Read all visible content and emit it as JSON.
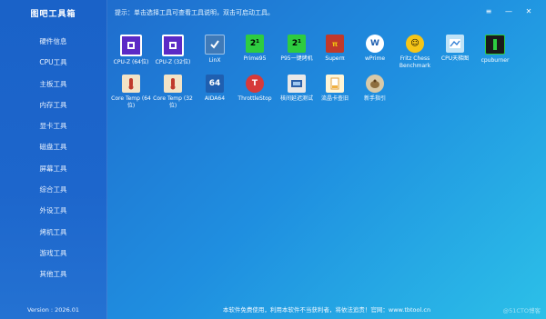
{
  "app": {
    "title": "图吧工具箱",
    "version": "Version : 2026.01"
  },
  "sidebar": {
    "items": [
      {
        "label": "硬件信息"
      },
      {
        "label": "CPU工具"
      },
      {
        "label": "主板工具"
      },
      {
        "label": "内存工具"
      },
      {
        "label": "显卡工具"
      },
      {
        "label": "磁盘工具"
      },
      {
        "label": "屏幕工具"
      },
      {
        "label": "综合工具"
      },
      {
        "label": "外设工具"
      },
      {
        "label": "烤机工具"
      },
      {
        "label": "游戏工具"
      },
      {
        "label": "其他工具"
      }
    ]
  },
  "topbar": {
    "hint": "提示：单击选择工具可查看工具说明，双击可启动工具。",
    "menu_icon": "≡",
    "minimize_icon": "—",
    "close_icon": "✕"
  },
  "tools": [
    {
      "label": "CPU-Z (64位)",
      "icon": "cpu-chip-icon",
      "color": "#5b2ac6"
    },
    {
      "label": "CPU-Z (32位)",
      "icon": "cpu-chip-icon",
      "color": "#5b2ac6"
    },
    {
      "label": "LinX",
      "icon": "linx-icon",
      "color": "#3f7ab8"
    },
    {
      "label": "Prime95",
      "icon": "prime95-icon",
      "color": "#2ecc40"
    },
    {
      "label": "P95一键烤机",
      "icon": "prime95-icon",
      "color": "#2ecc40"
    },
    {
      "label": "Superπ",
      "icon": "superpi-icon",
      "color": "#c0392b"
    },
    {
      "label": "wPrime",
      "icon": "wprime-icon",
      "color": "#ffffff"
    },
    {
      "label": "Fritz Chess Benchmark",
      "icon": "fritz-smiley-icon",
      "color": "#f5c518"
    },
    {
      "label": "CPU天梯图",
      "icon": "cpu-ladder-icon",
      "color": "#bfe3f7"
    },
    {
      "label": "cpuburner",
      "icon": "cpuburner-icon",
      "color": "#1a1a1a"
    },
    {
      "label": "Core Temp (64位)",
      "icon": "thermometer-icon",
      "color": "#f2e3c6"
    },
    {
      "label": "Core Temp (32位)",
      "icon": "thermometer-icon",
      "color": "#f2e3c6"
    },
    {
      "label": "AIDA64",
      "icon": "aida64-icon",
      "color": "#1f5fb0",
      "text": "64"
    },
    {
      "label": "ThrottleStop",
      "icon": "throttlestop-icon",
      "color": "#d63a3a",
      "text": "T"
    },
    {
      "label": "核间延迟测试",
      "icon": "latency-icon",
      "color": "#e8e8e8"
    },
    {
      "label": "流晶卡查旧",
      "icon": "document-icon",
      "color": "#fff5d6"
    },
    {
      "label": "新手指引",
      "icon": "teapot-icon",
      "color": "#d8c9a8"
    }
  ],
  "footer": {
    "text": "本软件免费使用，利用本软件不当获利者，将依法追责！官网：www.tbtool.cn",
    "watermark": "@51CTO博客"
  }
}
